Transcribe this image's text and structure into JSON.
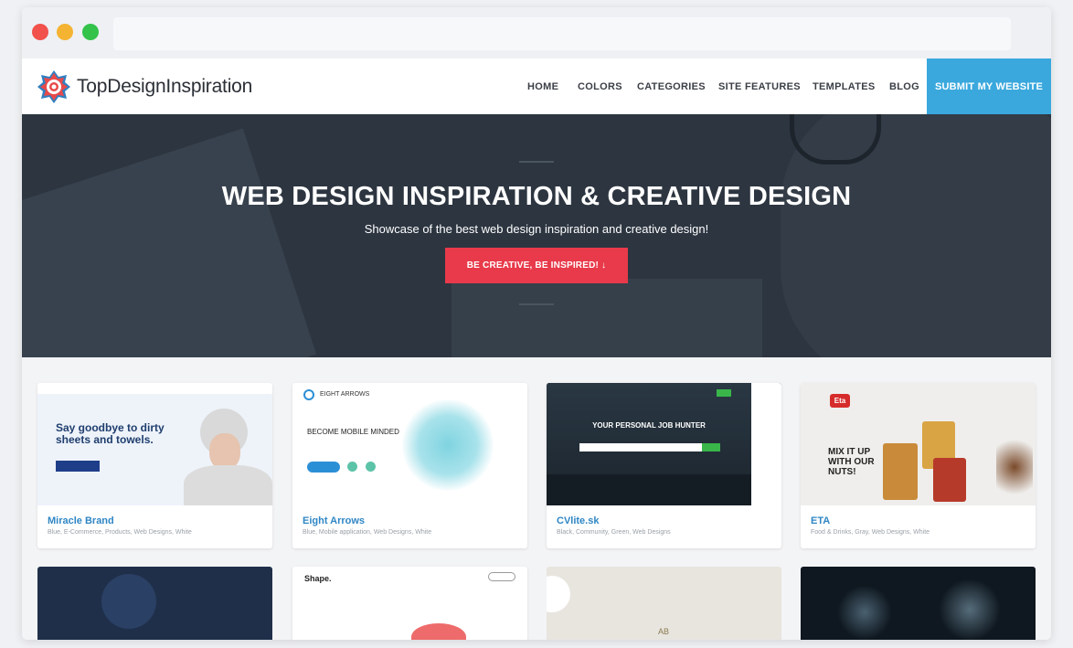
{
  "nav": {
    "brand": "TopDesignInspiration",
    "items": [
      "HOME",
      "COLORS",
      "CATEGORIES",
      "SITE FEATURES",
      "TEMPLATES",
      "BLOG"
    ],
    "submit_label": "SUBMIT MY WEBSITE"
  },
  "hero": {
    "title": "WEB DESIGN INSPIRATION & CREATIVE DESIGN",
    "subtitle": "Showcase of the best web design inspiration and creative design!",
    "cta_label": "BE CREATIVE, BE INSPIRED! ↓"
  },
  "cards": [
    {
      "title": "Miracle Brand",
      "tags": "Blue, E-Commerce, Products, Web Designs, White",
      "thumb_heading": "Say goodbye to dirty sheets and towels."
    },
    {
      "title": "Eight Arrows",
      "tags": "Blue, Mobile application, Web Designs, White",
      "thumb_brand": "EIGHT ARROWS",
      "thumb_heading": "BECOME MOBILE MINDED"
    },
    {
      "title": "CVlite.sk",
      "tags": "Black, Community, Green, Web Designs",
      "thumb_heading": "YOUR PERSONAL JOB HUNTER"
    },
    {
      "title": "ETA",
      "tags": "Food & Drinks, Gray, Web Designs, White",
      "thumb_logo": "Eta",
      "thumb_heading": "MIX IT UP WITH OUR NUTS!"
    }
  ],
  "second_row": [
    {
      "thumb_text": ""
    },
    {
      "thumb_text": "Shape."
    },
    {
      "thumb_text": "AB"
    },
    {
      "thumb_text": ""
    }
  ],
  "colors": {
    "accent_blue": "#3aa8dd",
    "cta_red": "#e83a4a",
    "hero_bg": "#2c3540",
    "link_blue": "#2f86c4"
  }
}
